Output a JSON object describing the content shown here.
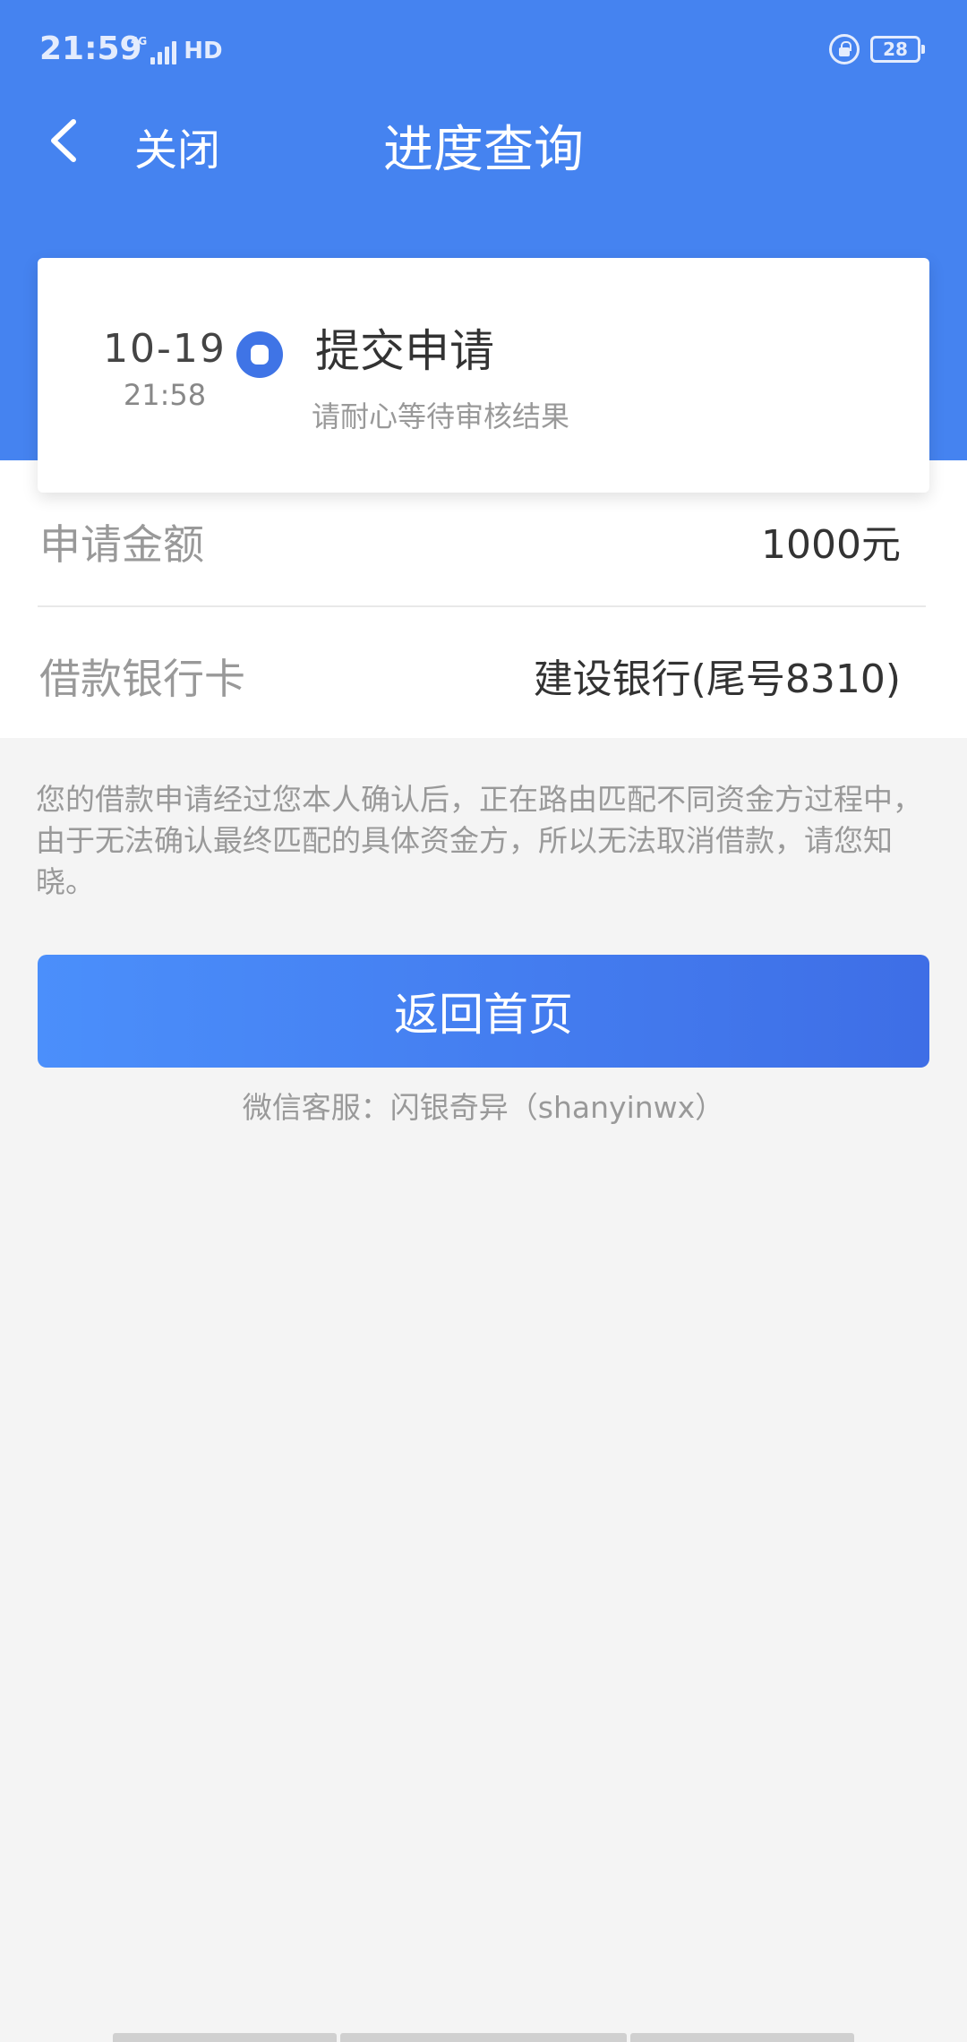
{
  "status_bar": {
    "time": "21:59",
    "network": "4G",
    "hd": "HD",
    "battery": "28"
  },
  "nav": {
    "close_label": "关闭",
    "title": "进度查询"
  },
  "progress": {
    "date": "10-19",
    "time": "21:58",
    "step_title": "提交申请",
    "step_desc": "请耐心等待审核结果"
  },
  "info": {
    "amount_label": "申请金额",
    "amount_value": "1000元",
    "card_label": "借款银行卡",
    "card_value": "建设银行(尾号8310)"
  },
  "notice": "您的借款申请经过您本人确认后，正在路由匹配不同资金方过程中，由于无法确认最终匹配的具体资金方，所以无法取消借款，请您知晓。",
  "button": {
    "home_label": "返回首页"
  },
  "service": "微信客服：闪银奇异（shanyinwx）",
  "colors": {
    "brand": "#4583f0",
    "button_start": "#4b8ffb",
    "button_end": "#3e6ee6",
    "background": "#f4f4f4"
  }
}
